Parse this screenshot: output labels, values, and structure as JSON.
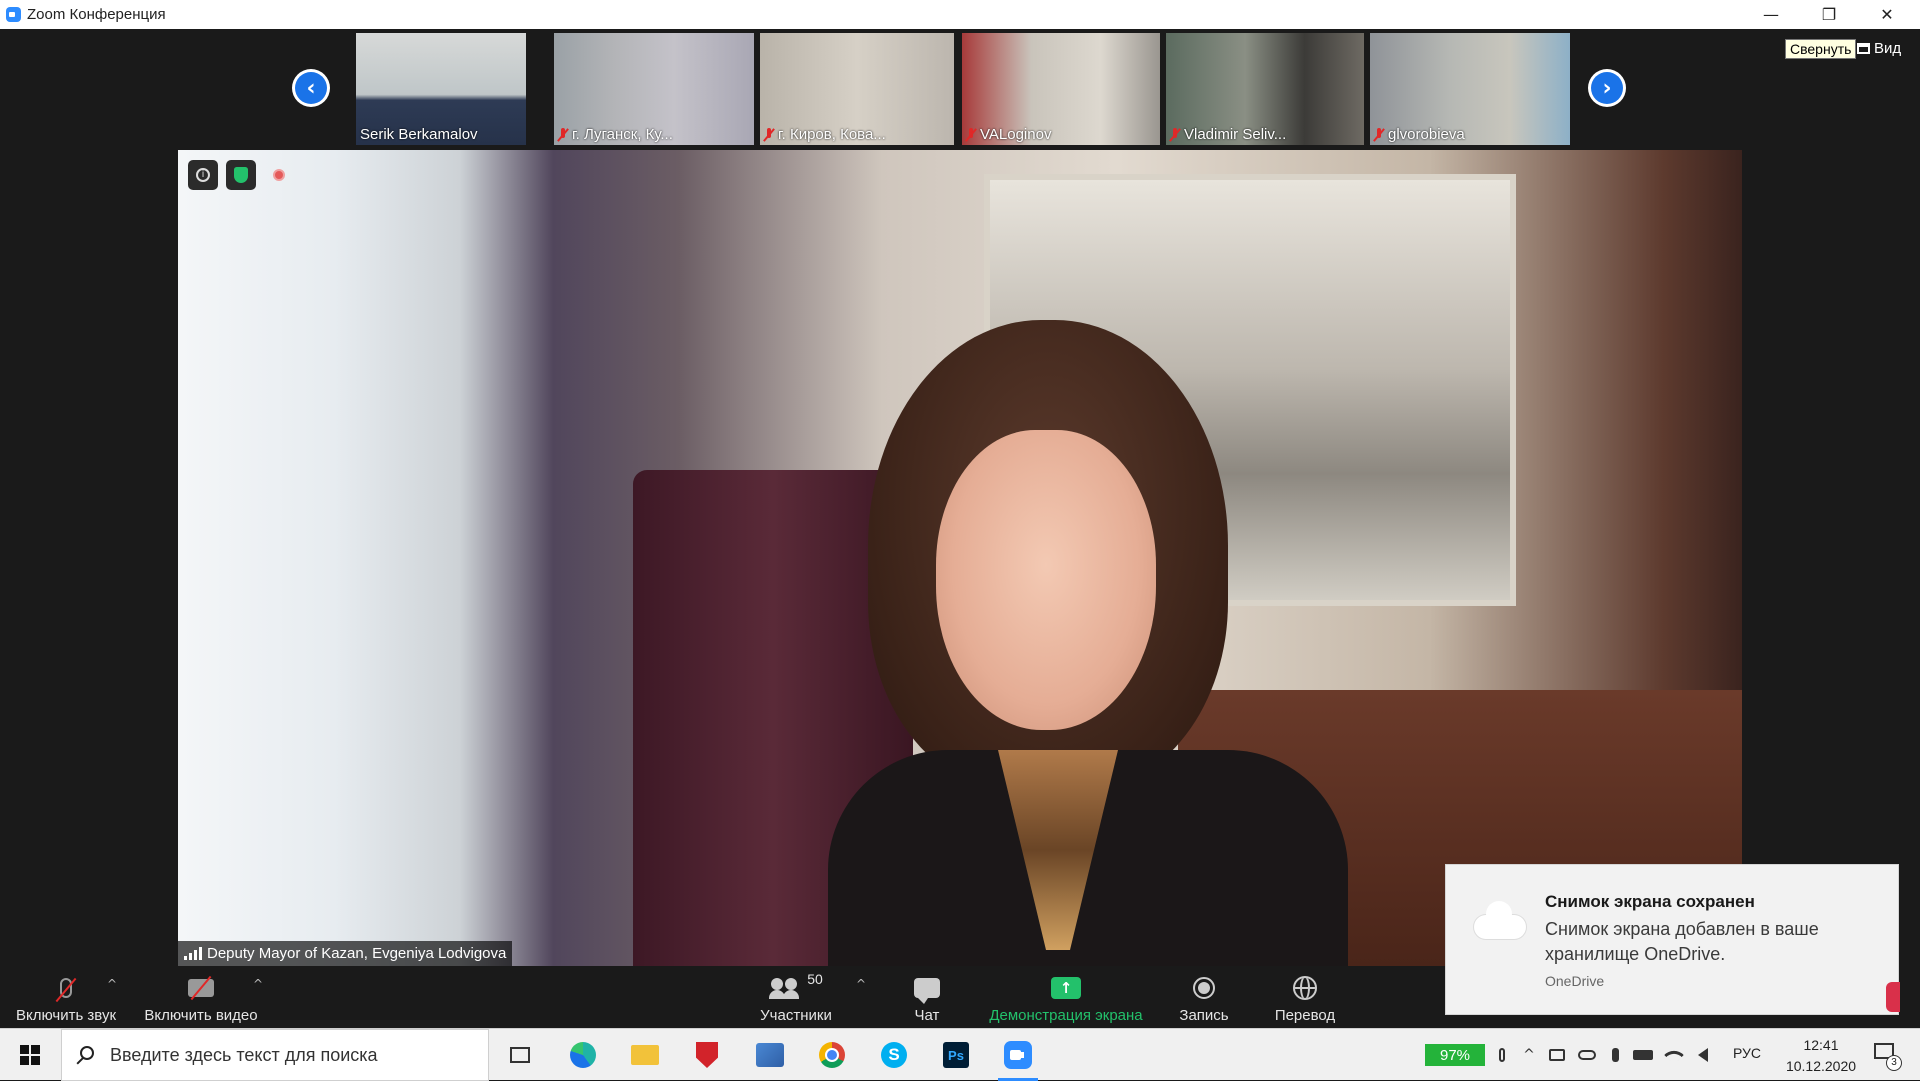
{
  "window": {
    "title": "Zoom Конференция",
    "minimize_glyph": "—",
    "restore_glyph": "❐",
    "close_glyph": "✕"
  },
  "strip": {
    "prev_glyph": "‹",
    "next_glyph": "›",
    "tooltip": "Свернуть",
    "view_label": "Вид",
    "participants": [
      {
        "name": "Serik Berkamalov",
        "muted": false
      },
      {
        "name": "г. Луганск, Ку...",
        "muted": true
      },
      {
        "name": "г. Киров, Кова...",
        "muted": true
      },
      {
        "name": "VALoginov",
        "muted": true
      },
      {
        "name": "Vladimir Seliv...",
        "muted": true
      },
      {
        "name": "glvorobieva",
        "muted": true
      }
    ]
  },
  "main_video": {
    "speaker_name": "Deputy Mayor of Kazan, Evgeniya Lodvigova",
    "info_glyph": "i"
  },
  "toolbar": {
    "caret_glyph": "^",
    "unmute_label": "Включить звук",
    "start_video_label": "Включить видео",
    "participants_label": "Участники",
    "participants_count": "50",
    "chat_label": "Чат",
    "share_label": "Демонстрация экрана",
    "share_glyph": "↑",
    "record_label": "Запись",
    "translate_label": "Перевод"
  },
  "notification": {
    "title": "Снимок экрана сохранен",
    "body": "Снимок экрана добавлен в ваше хранилище OneDrive.",
    "source": "OneDrive"
  },
  "taskbar": {
    "search_placeholder": "Введите здесь текст для поиска",
    "skype_glyph": "S",
    "ps_label": "Ps",
    "battery": "97%",
    "tray_chevron": "^",
    "language": "РУС",
    "time": "12:41",
    "date": "10.12.2020",
    "notification_count": "3",
    "accent_color": "#2d8cff"
  }
}
